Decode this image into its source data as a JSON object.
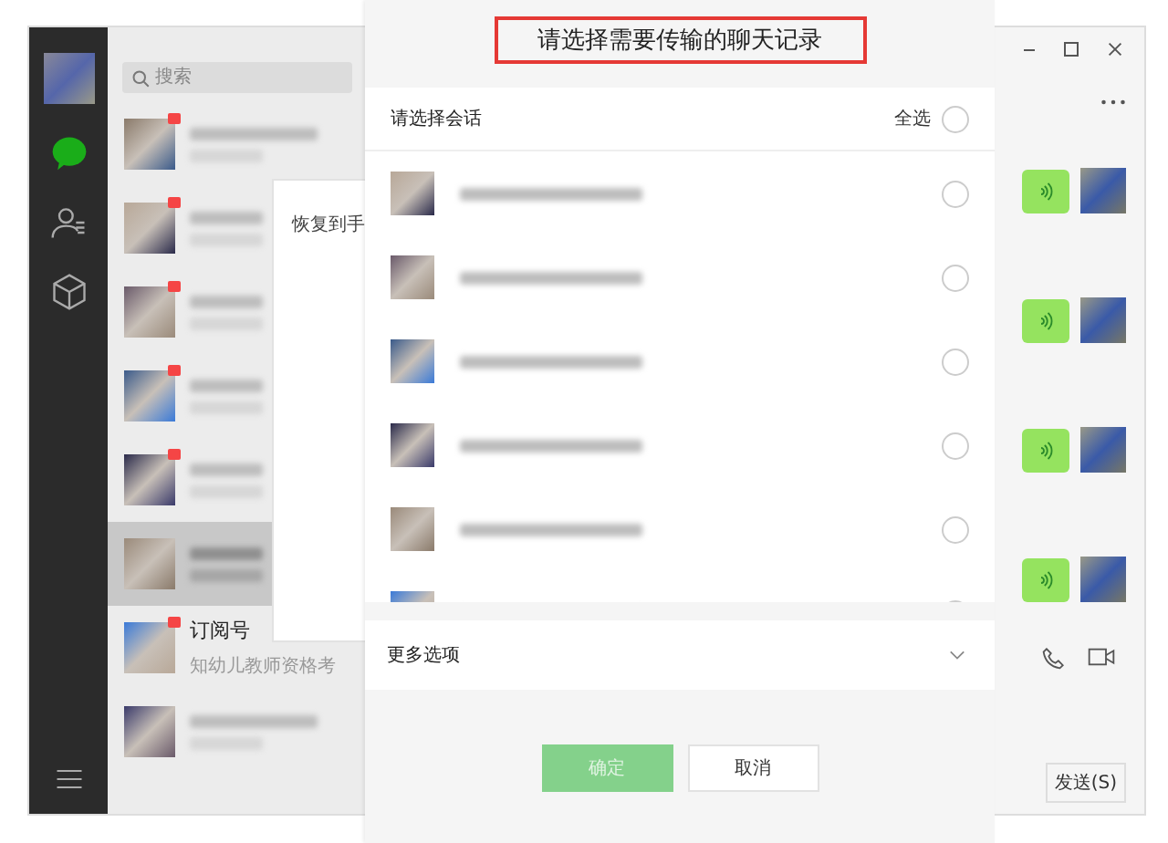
{
  "search": {
    "placeholder": "搜索"
  },
  "chats": [
    {
      "unread": true,
      "selected": false
    },
    {
      "unread": true,
      "selected": false
    },
    {
      "unread": true,
      "selected": false
    },
    {
      "unread": true,
      "selected": false
    },
    {
      "unread": true,
      "selected": false
    },
    {
      "unread": false,
      "selected": true
    },
    {
      "unread": true,
      "selected": false,
      "name": "订阅号",
      "preview": "知幼儿教师资格考"
    },
    {
      "unread": false,
      "selected": false
    }
  ],
  "restore_panel": {
    "title": "恢复到手"
  },
  "messages": [
    {
      "kind": "voice"
    },
    {
      "kind": "voice"
    },
    {
      "kind": "voice"
    },
    {
      "kind": "voice"
    }
  ],
  "send_button": "发送(S)",
  "dialog": {
    "title": "请选择需要传输的聊天记录",
    "section_label": "请选择会话",
    "select_all": {
      "label": "全选",
      "checked": false
    },
    "conversations": [
      {
        "selected": false
      },
      {
        "selected": false
      },
      {
        "selected": false
      },
      {
        "selected": false
      },
      {
        "selected": false
      },
      {
        "selected": false
      }
    ],
    "more_options": {
      "label": "更多选项",
      "expanded": false
    },
    "buttons": [
      {
        "label": "确定",
        "kind": "primary",
        "disabled": true
      },
      {
        "label": "取消",
        "kind": "secondary",
        "disabled": false
      }
    ]
  }
}
